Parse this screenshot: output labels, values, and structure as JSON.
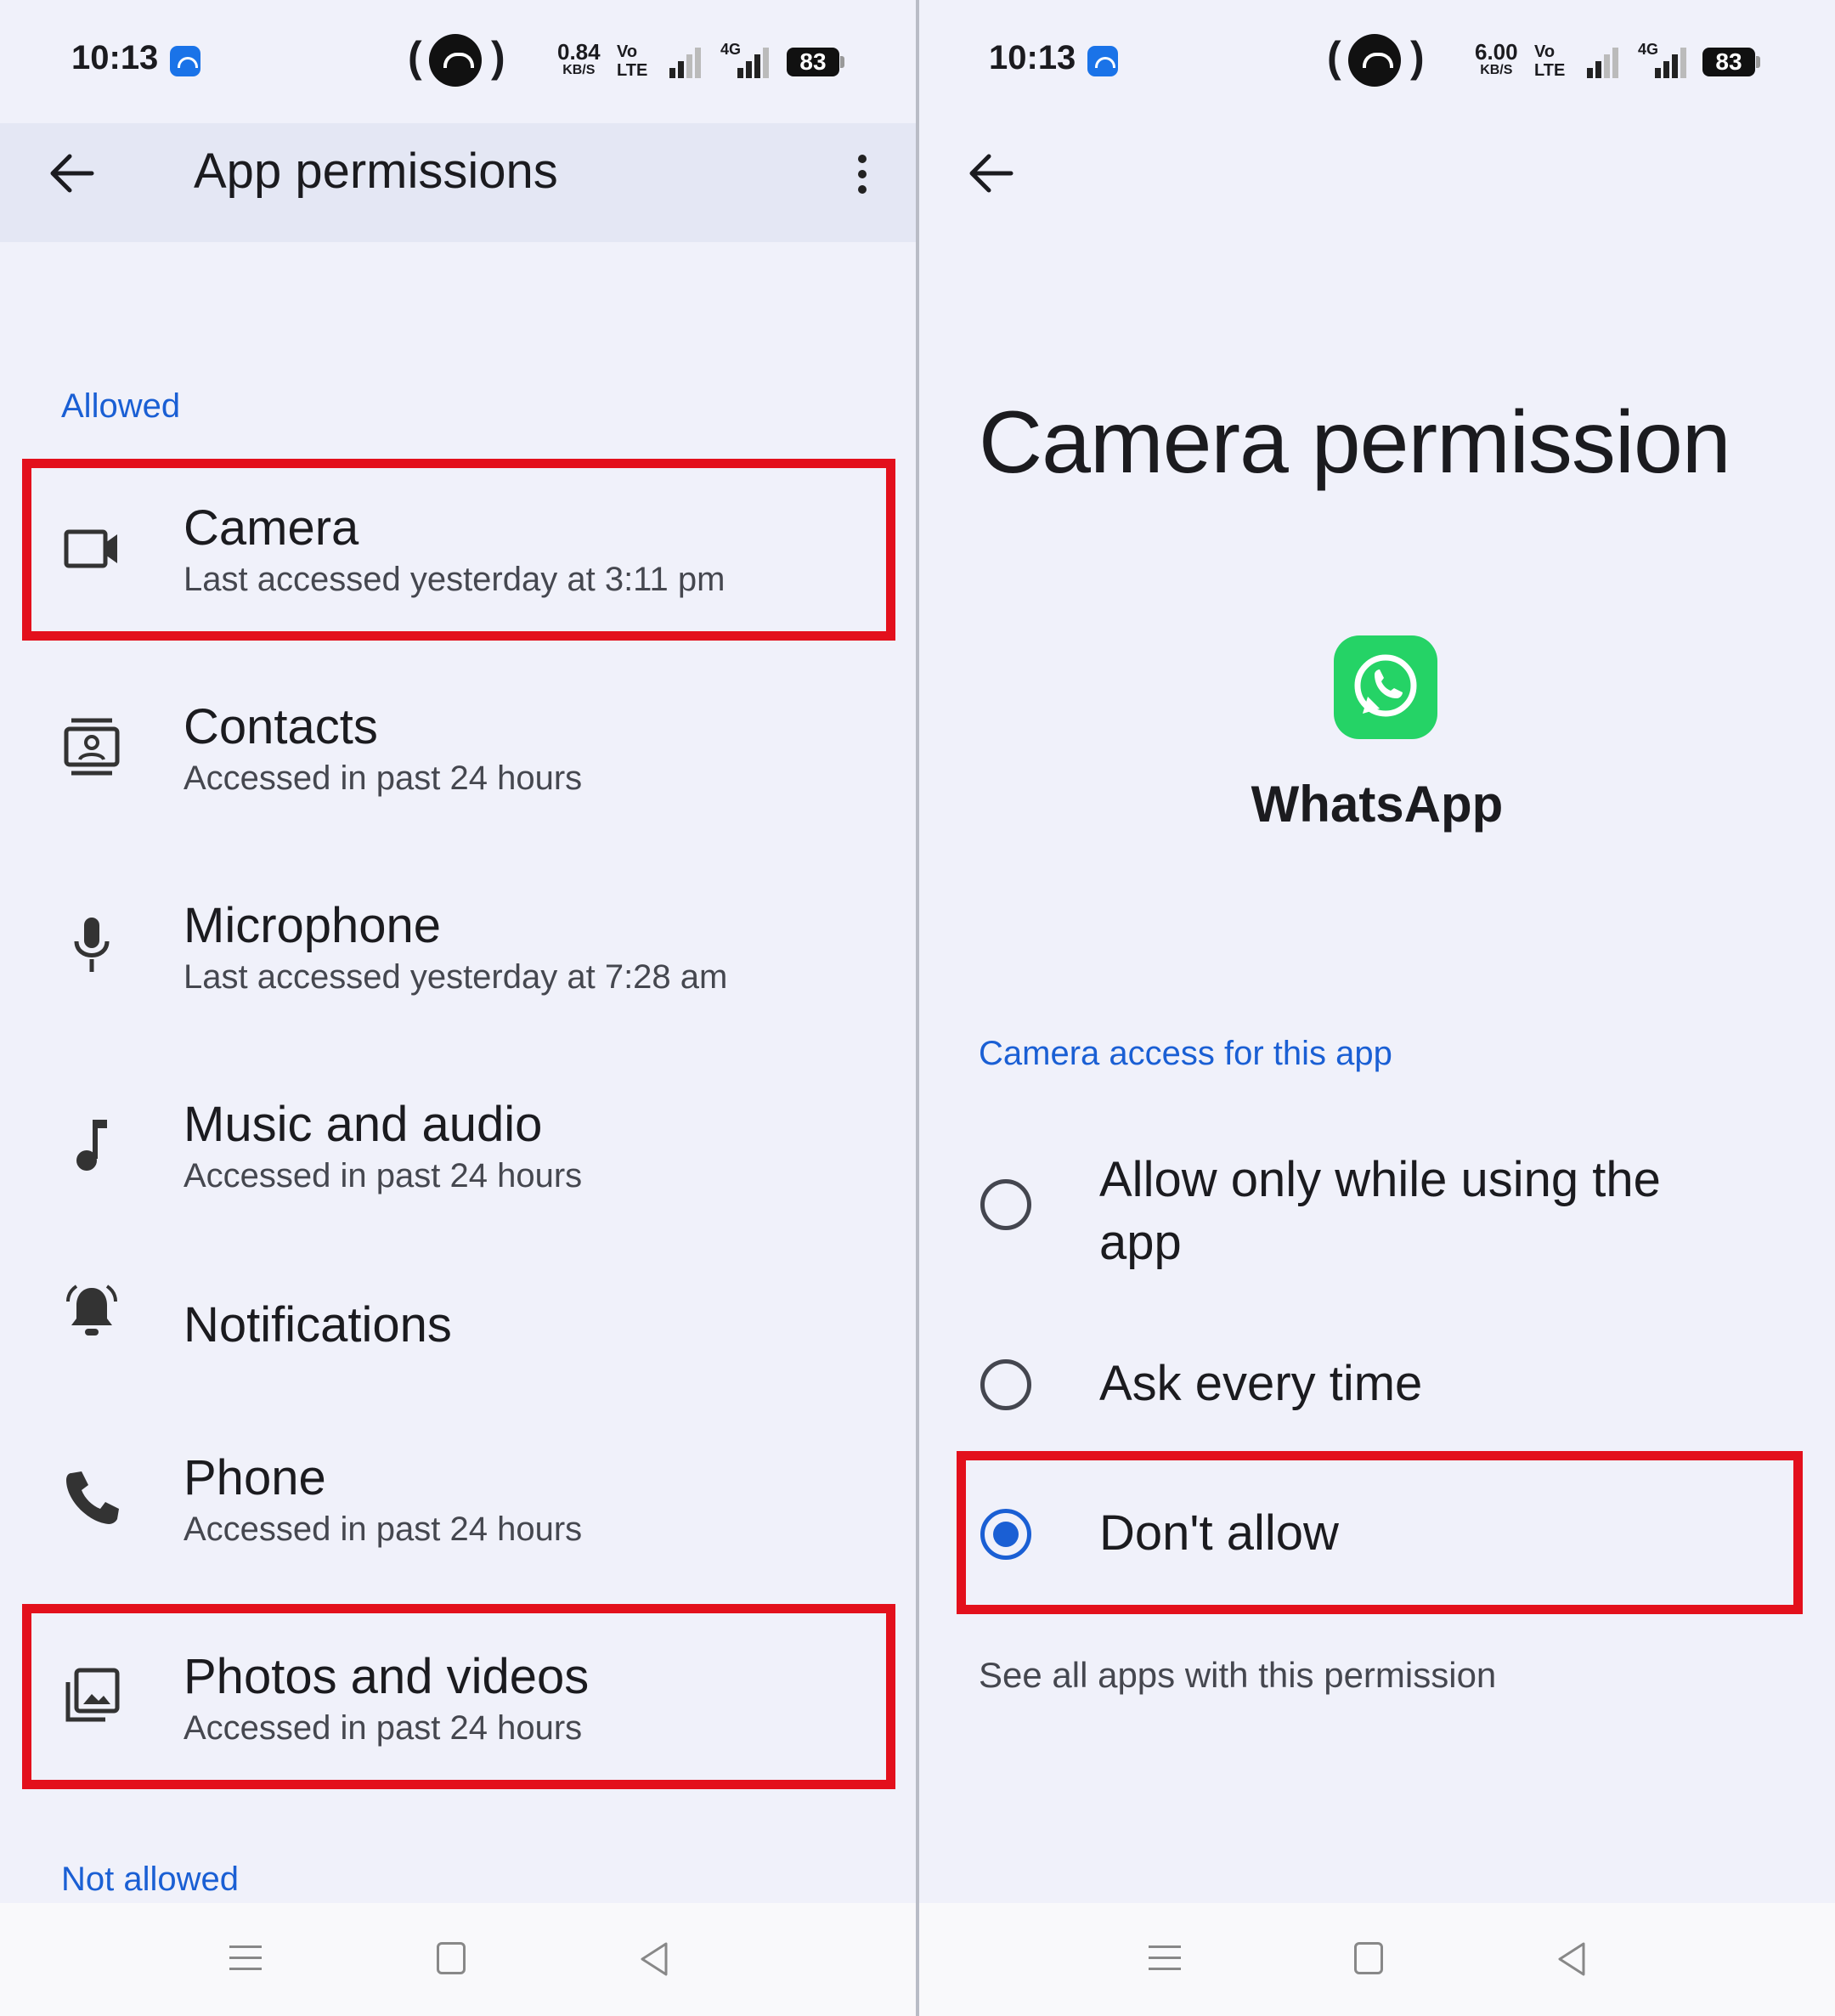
{
  "left": {
    "status": {
      "time": "10:13",
      "speed": "0.84",
      "speed_unit": "KB/S",
      "network": "4G",
      "battery": "83"
    },
    "appbar": {
      "title": "App permissions"
    },
    "allowed_label": "Allowed",
    "permissions": [
      {
        "title": "Camera",
        "subtitle": "Last accessed yesterday at 3:11 pm",
        "icon": "camera-icon",
        "highlighted": true
      },
      {
        "title": "Contacts",
        "subtitle": "Accessed in past 24 hours",
        "icon": "contacts-icon",
        "highlighted": false
      },
      {
        "title": "Microphone",
        "subtitle": "Last accessed yesterday at 7:28 am",
        "icon": "microphone-icon",
        "highlighted": false
      },
      {
        "title": "Music and audio",
        "subtitle": "Accessed in past 24 hours",
        "icon": "music-note-icon",
        "highlighted": false
      },
      {
        "title": "Notifications",
        "subtitle": "",
        "icon": "bell-icon",
        "highlighted": false
      },
      {
        "title": "Phone",
        "subtitle": "Accessed in past 24 hours",
        "icon": "phone-icon",
        "highlighted": false
      },
      {
        "title": "Photos and videos",
        "subtitle": "Accessed in past 24 hours",
        "icon": "photos-icon",
        "highlighted": true
      }
    ],
    "not_allowed_label": "Not allowed"
  },
  "right": {
    "status": {
      "time": "10:13",
      "speed": "6.00",
      "speed_unit": "KB/S",
      "network": "4G",
      "battery": "83"
    },
    "title": "Camera permission",
    "app_name": "WhatsApp",
    "section_label": "Camera access for this app",
    "options": [
      {
        "label": "Allow only while using the app",
        "selected": false
      },
      {
        "label": "Ask every time",
        "selected": false
      },
      {
        "label": "Don't allow",
        "selected": true,
        "highlighted": true
      }
    ],
    "see_all": "See all apps with this permission"
  },
  "colors": {
    "accent": "#1a5fd4",
    "highlight": "#e3101c",
    "background": "#f0f1fa",
    "whatsapp": "#25d366"
  }
}
